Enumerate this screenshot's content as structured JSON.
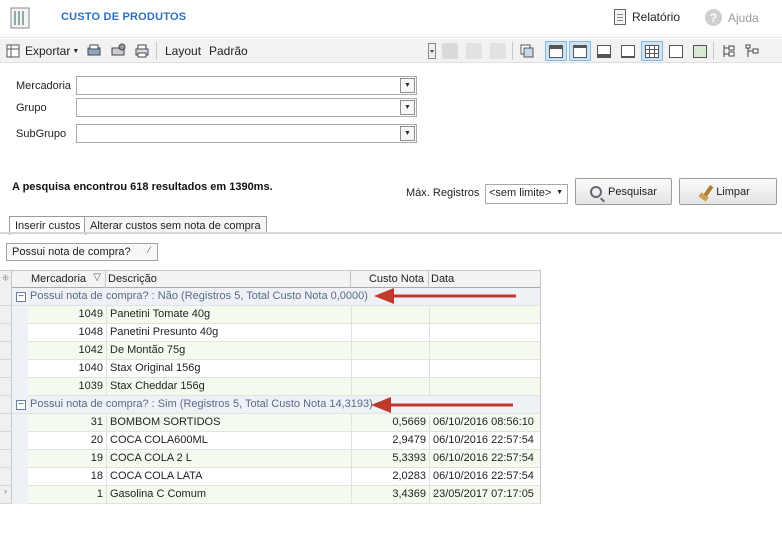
{
  "header": {
    "title": "CUSTO DE PRODUTOS",
    "relatorio_label": "Relatório",
    "ajuda_label": "Ajuda"
  },
  "toolbar": {
    "exportar_label": "Exportar",
    "layout_label": "Layout",
    "padrao_label": "Padrão"
  },
  "filters": {
    "mercadoria_label": "Mercadoria",
    "grupo_label": "Grupo",
    "subgrupo_label": "SubGrupo",
    "mercadoria_value": "",
    "grupo_value": "",
    "subgrupo_value": ""
  },
  "search": {
    "result_text": "A pesquisa encontrou 618 resultados em 1390ms.",
    "max_label": "Máx. Registros",
    "max_value": "<sem limite>",
    "pesquisar_label": "Pesquisar",
    "limpar_label": "Limpar"
  },
  "tabs": [
    {
      "label": "Inserir custos"
    },
    {
      "label": "Alterar custos sem nota de compra"
    }
  ],
  "group_chip": {
    "label": "Possui nota de compra?"
  },
  "grid": {
    "columns": [
      "Mercadoria",
      "Descrição",
      "Custo Nota",
      "Data"
    ],
    "groups": [
      {
        "label": "Possui nota de compra? : Não (Registros 5, Total Custo Nota 0,0000)",
        "rows": [
          {
            "mercadoria": "1049",
            "descricao": "Panetini Tomate 40g",
            "custo": "",
            "data": ""
          },
          {
            "mercadoria": "1048",
            "descricao": "Panetini Presunto 40g",
            "custo": "",
            "data": ""
          },
          {
            "mercadoria": "1042",
            "descricao": "De Montão 75g",
            "custo": "",
            "data": ""
          },
          {
            "mercadoria": "1040",
            "descricao": "Stax Original 156g",
            "custo": "",
            "data": ""
          },
          {
            "mercadoria": "1039",
            "descricao": "Stax Cheddar 156g",
            "custo": "",
            "data": ""
          }
        ]
      },
      {
        "label": "Possui nota de compra? : Sim (Registros 5, Total Custo Nota 14,3193)",
        "rows": [
          {
            "mercadoria": "31",
            "descricao": "BOMBOM SORTIDOS",
            "custo": "0,5669",
            "data": "06/10/2016 08:56:10"
          },
          {
            "mercadoria": "20",
            "descricao": "COCA COLA600ML",
            "custo": "2,9479",
            "data": "06/10/2016 22:57:54"
          },
          {
            "mercadoria": "19",
            "descricao": "COCA COLA 2 L",
            "custo": "5,3393",
            "data": "06/10/2016 22:57:54"
          },
          {
            "mercadoria": "18",
            "descricao": "COCA COLA LATA",
            "custo": "2,0283",
            "data": "06/10/2016 22:57:54"
          },
          {
            "mercadoria": "1",
            "descricao": "Gasolina C Comum",
            "custo": "3,4369",
            "data": "23/05/2017 07:17:05"
          }
        ]
      }
    ]
  },
  "colors": {
    "title_blue": "#2c6fc0",
    "annotation_arrow": "#c0392b"
  }
}
